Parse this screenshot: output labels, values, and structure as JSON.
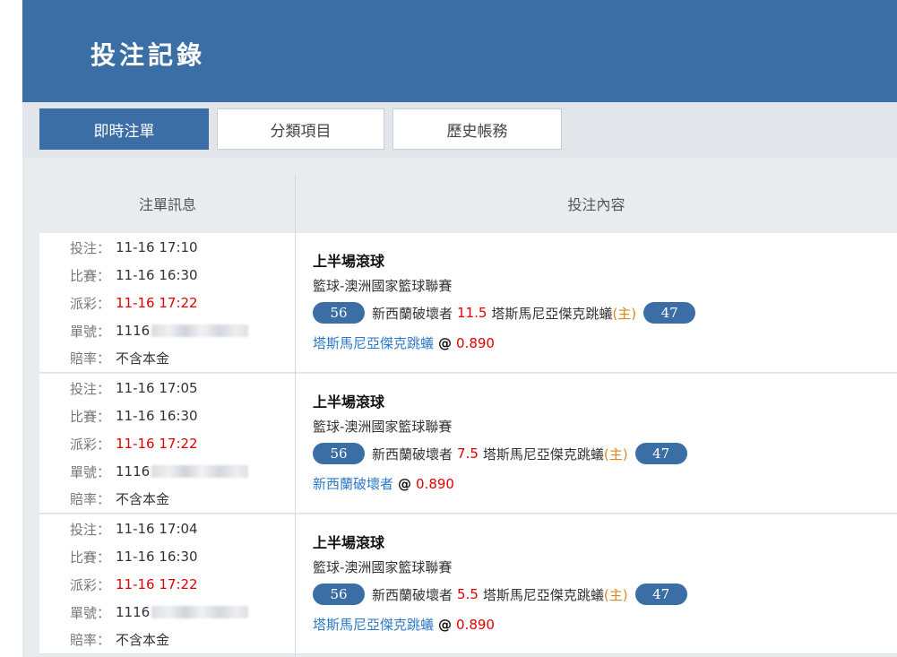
{
  "header": {
    "title": "投注記錄"
  },
  "tabs": [
    {
      "label": "即時注單",
      "active": true
    },
    {
      "label": "分類項目",
      "active": false
    },
    {
      "label": "歷史帳務",
      "active": false
    }
  ],
  "columns": {
    "info": "注單訊息",
    "content": "投注內容"
  },
  "labels": {
    "bet_time": "投注：",
    "match_time": "比賽：",
    "payout_time": "派彩：",
    "ticket_no": "單號：",
    "odds_type": "賠率："
  },
  "bets": [
    {
      "bet_time": "11-16 17:10",
      "match_time": "11-16 16:30",
      "payout_time": "11-16 17:22",
      "ticket_prefix": "1116",
      "odds_type": "不含本金",
      "market": "上半場滾球",
      "league": "籃球-澳洲國家籃球聯賽",
      "score_left": "56",
      "team_a": "新西蘭破壞者",
      "handicap": "11.5",
      "team_b": "塔斯馬尼亞傑克跳蟻",
      "home_marker": "(主)",
      "score_right": "47",
      "pick": "塔斯馬尼亞傑克跳蟻",
      "at": "@",
      "odds": "0.890"
    },
    {
      "bet_time": "11-16 17:05",
      "match_time": "11-16 16:30",
      "payout_time": "11-16 17:22",
      "ticket_prefix": "1116",
      "odds_type": "不含本金",
      "market": "上半場滾球",
      "league": "籃球-澳洲國家籃球聯賽",
      "score_left": "56",
      "team_a": "新西蘭破壞者",
      "handicap": "7.5",
      "team_b": "塔斯馬尼亞傑克跳蟻",
      "home_marker": "(主)",
      "score_right": "47",
      "pick": "新西蘭破壞者",
      "at": "@",
      "odds": "0.890"
    },
    {
      "bet_time": "11-16 17:04",
      "match_time": "11-16 16:30",
      "payout_time": "11-16 17:22",
      "ticket_prefix": "1116",
      "odds_type": "不含本金",
      "market": "上半場滾球",
      "league": "籃球-澳洲國家籃球聯賽",
      "score_left": "56",
      "team_a": "新西蘭破壞者",
      "handicap": "5.5",
      "team_b": "塔斯馬尼亞傑克跳蟻",
      "home_marker": "(主)",
      "score_right": "47",
      "pick": "塔斯馬尼亞傑克跳蟻",
      "at": "@",
      "odds": "0.890"
    }
  ],
  "colors": {
    "brand": "#3a6ea5",
    "accent_red": "#e00000",
    "pick_blue": "#2d79c7",
    "home_orange": "#d68a1e"
  }
}
